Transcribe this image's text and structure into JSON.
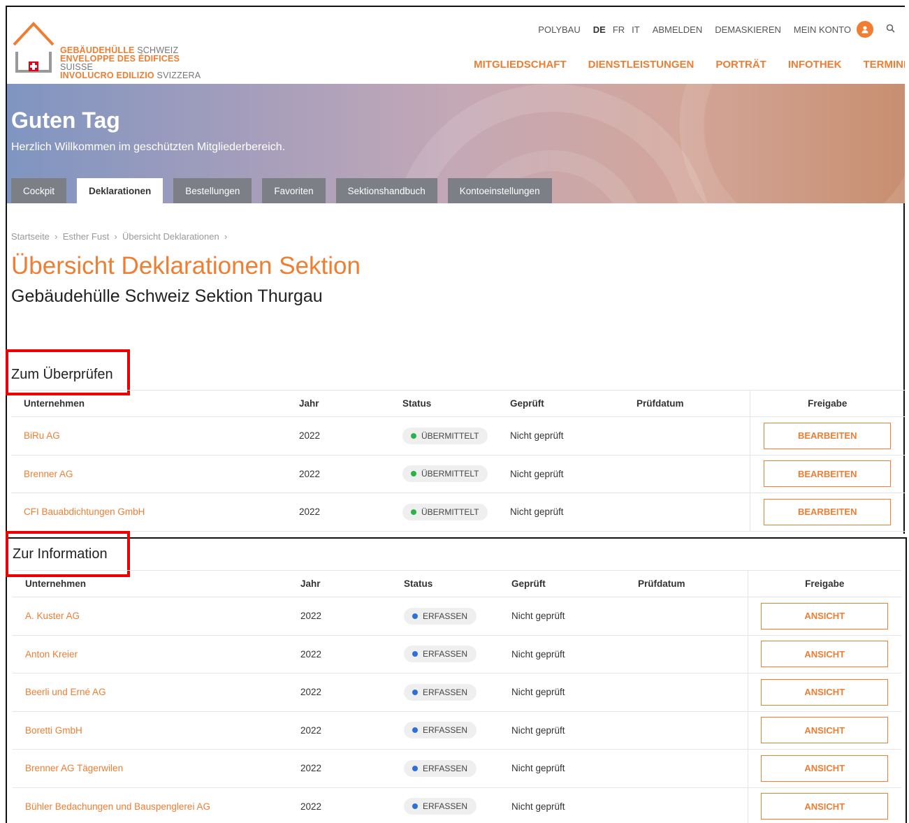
{
  "logo": {
    "line1_bold": "GEBÄUDEHÜLLE",
    "line1_rest": "SCHWEIZ",
    "line2_bold": "ENVELOPPE DES ÉDIFICES",
    "line2_rest": "SUISSE",
    "line3_bold": "INVOLUCRO EDILIZIO",
    "line3_rest": "SVIZZERA"
  },
  "topnav": {
    "polybau": "POLYBAU",
    "lang_de": "DE",
    "lang_fr": "FR",
    "lang_it": "IT",
    "abmelden": "ABMELDEN",
    "demaskieren": "DEMASKIEREN",
    "mein_konto": "MEIN KONTO"
  },
  "mainnav": [
    "MITGLIEDSCHAFT",
    "DIENSTLEISTUNGEN",
    "PORTRÄT",
    "INFOTHEK",
    "TERMINE"
  ],
  "hero": {
    "title": "Guten Tag",
    "subtitle": "Herzlich Willkommen im geschützten Mitgliederbereich.",
    "tabs": [
      "Cockpit",
      "Deklarationen",
      "Bestellungen",
      "Favoriten",
      "Sektionshandbuch",
      "Kontoeinstellungen"
    ],
    "active_tab": "Deklarationen"
  },
  "breadcrumb": [
    "Startseite",
    "Esther Fust",
    "Übersicht Deklarationen"
  ],
  "page_title": "Übersicht Deklarationen Sektion",
  "page_subtitle": "Gebäudehülle Schweiz Sektion Thurgau",
  "columns": [
    "Unternehmen",
    "Jahr",
    "Status",
    "Geprüft",
    "Prüfdatum",
    "Freigabe"
  ],
  "review": {
    "title": "Zum Überprüfen",
    "rows": [
      {
        "company": "BiRu AG",
        "year": "2022",
        "status": "ÜBERMITTELT",
        "checked": "Nicht geprüft",
        "date": "",
        "action": "BEARBEITEN"
      },
      {
        "company": "Brenner AG",
        "year": "2022",
        "status": "ÜBERMITTELT",
        "checked": "Nicht geprüft",
        "date": "",
        "action": "BEARBEITEN"
      },
      {
        "company": "CFI Bauabdichtungen GmbH",
        "year": "2022",
        "status": "ÜBERMITTELT",
        "checked": "Nicht geprüft",
        "date": "",
        "action": "BEARBEITEN"
      }
    ]
  },
  "info": {
    "title": "Zur Information",
    "rows": [
      {
        "company": "A. Kuster AG",
        "year": "2022",
        "status": "ERFASSEN",
        "checked": "Nicht geprüft",
        "date": "",
        "action": "ANSICHT"
      },
      {
        "company": "Anton Kreier",
        "year": "2022",
        "status": "ERFASSEN",
        "checked": "Nicht geprüft",
        "date": "",
        "action": "ANSICHT"
      },
      {
        "company": "Beerli und Erné AG",
        "year": "2022",
        "status": "ERFASSEN",
        "checked": "Nicht geprüft",
        "date": "",
        "action": "ANSICHT"
      },
      {
        "company": "Boretti GmbH",
        "year": "2022",
        "status": "ERFASSEN",
        "checked": "Nicht geprüft",
        "date": "",
        "action": "ANSICHT"
      },
      {
        "company": "Brenner AG Tägerwilen",
        "year": "2022",
        "status": "ERFASSEN",
        "checked": "Nicht geprüft",
        "date": "",
        "action": "ANSICHT"
      },
      {
        "company": "Bühler Bedachungen und Bauspenglerei AG",
        "year": "2022",
        "status": "ERFASSEN",
        "checked": "Nicht geprüft",
        "date": "",
        "action": "ANSICHT"
      }
    ]
  },
  "colors": {
    "accent": "#ef7d32",
    "status_sent": "#2bb34a",
    "status_draft": "#2f6fdc",
    "highlight": "#ee0000"
  }
}
